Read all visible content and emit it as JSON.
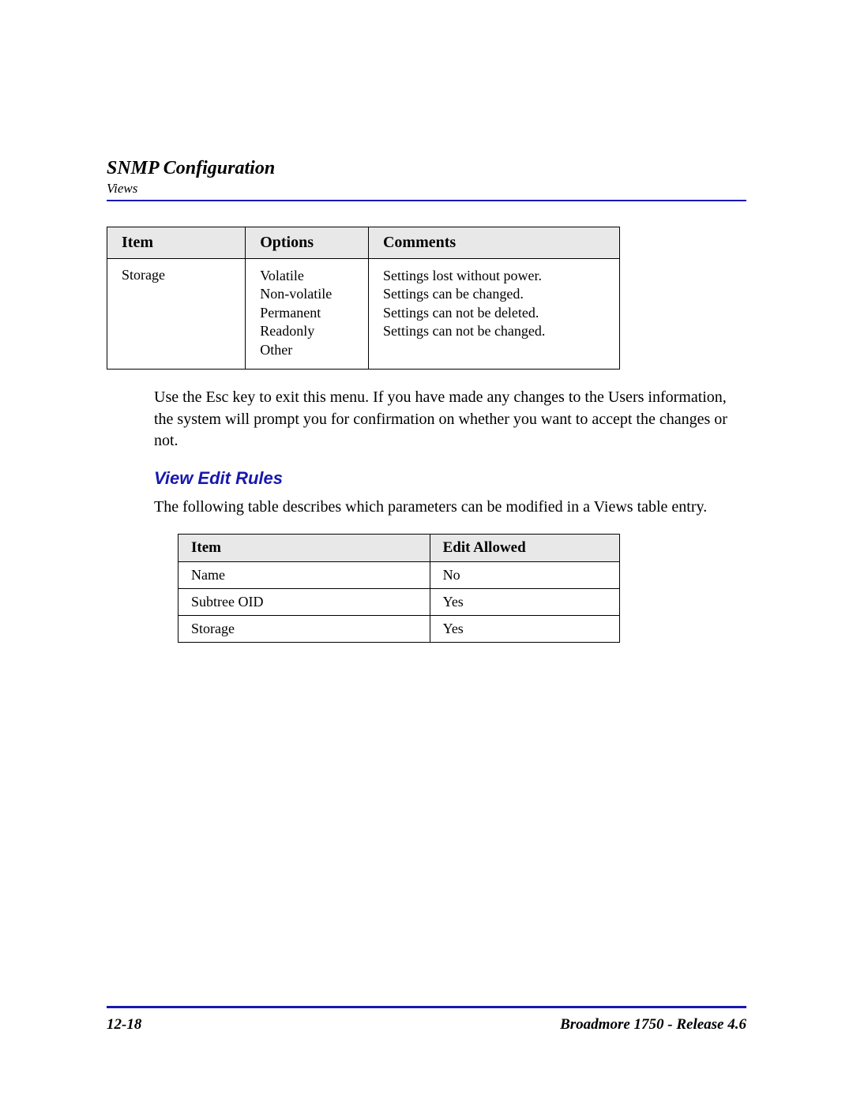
{
  "header": {
    "section_title": "SNMP Configuration",
    "subsection_label": "Views"
  },
  "table1": {
    "headers": {
      "item": "Item",
      "options": "Options",
      "comments": "Comments"
    },
    "row": {
      "item": "Storage",
      "options": [
        "Volatile",
        "Non-volatile",
        "Permanent",
        "Readonly",
        "Other"
      ],
      "comments": [
        "Settings lost without power.",
        "Settings can be changed.",
        "Settings can not be deleted.",
        "Settings can not be changed."
      ]
    }
  },
  "paragraph1": "Use the Esc key to exit this menu. If you have made any changes to the Users information, the system will prompt you for confirmation on whether you want to accept the changes or not.",
  "subsection_heading": "View Edit Rules",
  "paragraph2": "The following table describes which parameters can be modified in a Views table entry.",
  "table2": {
    "headers": {
      "item": "Item",
      "edit_allowed": "Edit Allowed"
    },
    "rows": [
      {
        "item": "Name",
        "edit_allowed": "No"
      },
      {
        "item": "Subtree OID",
        "edit_allowed": "Yes"
      },
      {
        "item": "Storage",
        "edit_allowed": "Yes"
      }
    ]
  },
  "footer": {
    "page_number": "12-18",
    "doc_title": "Broadmore 1750 - Release 4.6"
  }
}
